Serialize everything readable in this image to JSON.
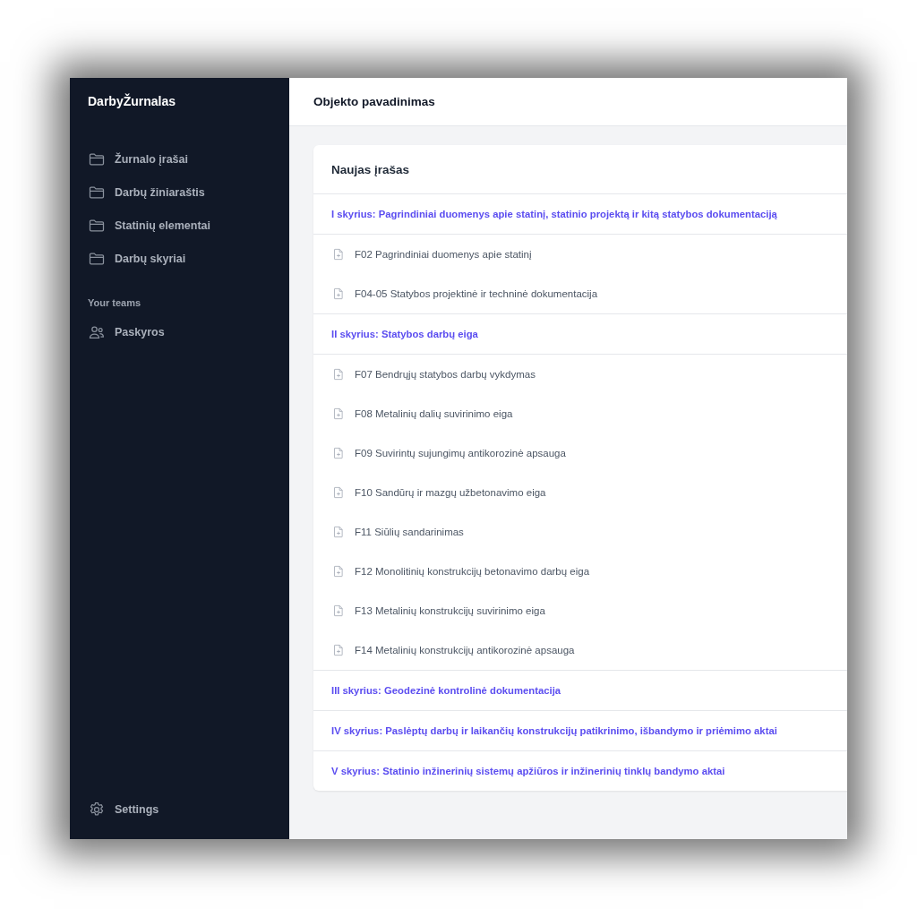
{
  "sidebar": {
    "brand": "DarbyŽurnalas",
    "items": [
      {
        "label": "Žurnalo įrašai"
      },
      {
        "label": "Darbų žiniaraštis"
      },
      {
        "label": "Statinių elementai"
      },
      {
        "label": "Darbų skyriai"
      }
    ],
    "section_label": "Your teams",
    "team_items": [
      {
        "label": "Paskyros"
      }
    ],
    "footer_items": [
      {
        "label": "Settings"
      }
    ]
  },
  "header": {
    "title": "Objekto pavadinimas"
  },
  "card": {
    "title": "Naujas įrašas",
    "sections": [
      {
        "title": "I skyrius: Pagrindiniai duomenys apie statinį, statinio projektą ir kitą statybos dokumentaciją",
        "items": [
          "F02 Pagrindiniai duomenys apie statinį",
          "F04-05 Statybos projektinė ir techninė dokumentacija"
        ]
      },
      {
        "title": "II skyrius: Statybos darbų eiga",
        "items": [
          "F07 Bendrųjų statybos darbų vykdymas",
          "F08 Metalinių dalių suvirinimo eiga",
          "F09 Suvirintų sujungimų antikorozinė apsauga",
          "F10 Sandūrų ir mazgų užbetonavimo eiga",
          "F11 Siūlių sandarinimas",
          "F12 Monolitinių konstrukcijų betonavimo darbų eiga",
          "F13 Metalinių konstrukcijų suvirinimo eiga",
          "F14 Metalinių konstrukcijų antikorozinė apsauga"
        ]
      },
      {
        "title": "III skyrius: Geodezinė kontrolinė dokumentacija"
      },
      {
        "title": "IV skyrius: Paslėptų darbų ir laikančių konstrukcijų patikrinimo, išbandymo ir priėmimo aktai"
      },
      {
        "title": "V skyrius: Statinio inžinerinių sistemų apžiūros ir inžinerinių tinklų bandymo aktai"
      }
    ]
  }
}
